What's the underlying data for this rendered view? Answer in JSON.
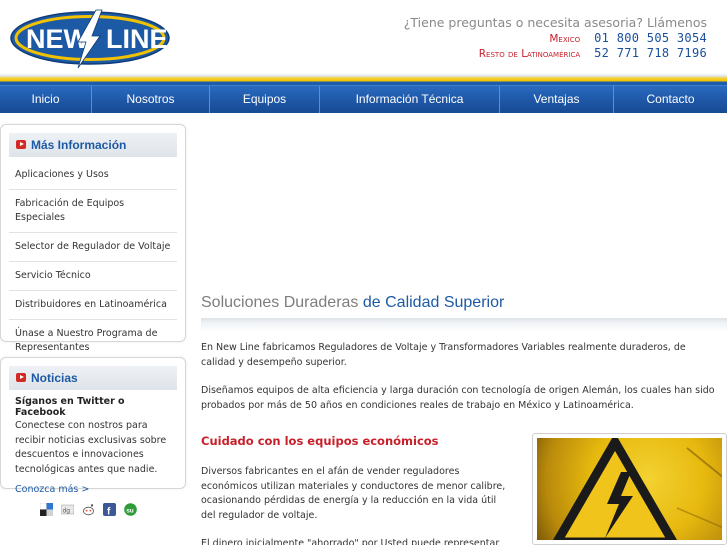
{
  "header": {
    "logo_text": "NEW LINE",
    "contact_question": "¿Tiene preguntas o necesita asesoria? Llámenos",
    "phones": [
      {
        "region": "Mexico",
        "number": "01 800 505 3054"
      },
      {
        "region": "Resto de Latinoamérica",
        "number": "52 771 718 7196"
      }
    ]
  },
  "nav": {
    "items": [
      {
        "label": "Inicio"
      },
      {
        "label": "Nosotros"
      },
      {
        "label": "Equipos"
      },
      {
        "label": "Información Técnica"
      },
      {
        "label": "Ventajas"
      },
      {
        "label": "Contacto"
      }
    ]
  },
  "sidebar": {
    "info_title": "Más Información",
    "info_items": [
      {
        "label": "Aplicaciones y Usos"
      },
      {
        "label": "Fabricación de Equipos Especiales"
      },
      {
        "label": "Selector de Regulador de Voltaje"
      },
      {
        "label": "Servicio Técnico"
      },
      {
        "label": "Distribuidores en Latinoamérica"
      },
      {
        "label": "Únase a Nuestro Programa de Representantes"
      }
    ],
    "news_title": "Noticias",
    "news_head": "Síganos en Twitter o Facebook",
    "news_text": "Conectese con nostros para recibir noticias exclusivas sobre descuentos e innovaciones tecnológicas antes que nadie.",
    "news_link": "Conozca más >",
    "social_icons": [
      "delicious-icon",
      "digg-icon",
      "reddit-icon",
      "facebook-icon",
      "stumbleupon-icon"
    ]
  },
  "main": {
    "hero_light": "Soluciones Duraderas",
    "hero_strong": "de Calidad Superior",
    "para1": "En New Line fabricamos Reguladores de Voltaje y Transformadores Variables realmente duraderos, de calidad y desempeño superior.",
    "para2": "Diseñamos equipos de alta eficiencia y larga duración con tecnología de origen Alemán, los cuales han sido probados por más de 50 años en condiciones reales de trabajo en México y Latinoamérica.",
    "section_title": "Cuidado con los equipos económicos",
    "para3": "Diversos fabricantes en el afán de vender reguladores económicos utilizan materiales y conductores de menor calibre, ocasionando pérdidas de energía y la reducción en la vida útil del regulador de voltaje.",
    "para4": "El dinero inicialmente \"ahorrado\" por Usted puede representar un"
  },
  "colors": {
    "brand_blue": "#1d5aa5",
    "accent_red": "#c8202a",
    "stripe_yellow": "#f2c200"
  }
}
